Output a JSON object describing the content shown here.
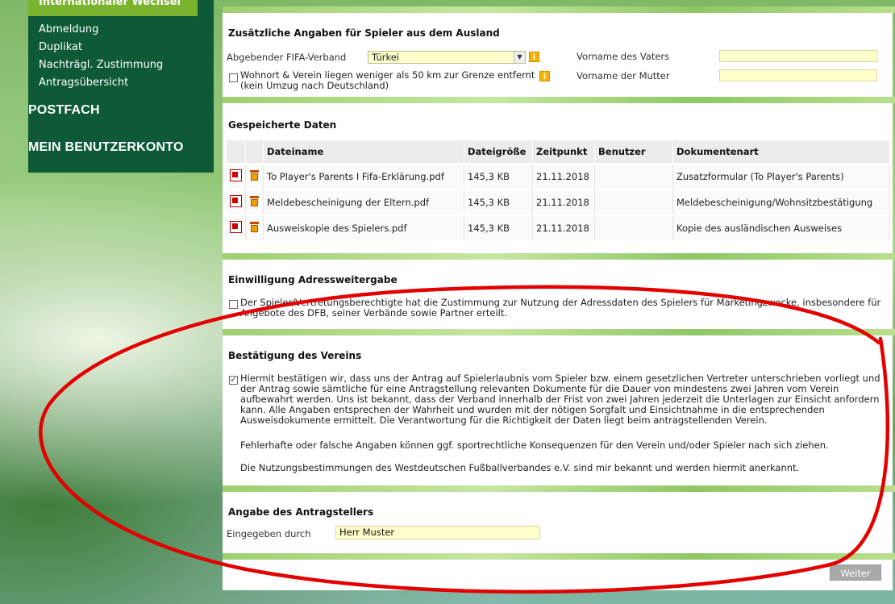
{
  "sidebar": {
    "active_item": "Internationaler Wechsel",
    "items": [
      "Abmeldung",
      "Duplikat",
      "Nachträgl. Zustimmung",
      "Antragsübersicht"
    ],
    "headings": [
      "POSTFACH",
      "MEIN BENUTZERKONTO"
    ]
  },
  "ausland": {
    "title": "Zusätzliche Angaben für Spieler aus dem Ausland",
    "fifa_label": "Abgebender FIFA-Verband",
    "fifa_value": "Türkei",
    "distance_label_1": "Wohnort & Verein liegen weniger als 50 km zur Grenze entfernt",
    "distance_label_2": "(kein Umzug nach Deutschland)",
    "father_label": "Vorname des Vaters",
    "mother_label": "Vorname der Mutter",
    "info_glyph": "i"
  },
  "files": {
    "title": "Gespeicherte Daten",
    "columns": [
      "Dateiname",
      "Dateigröße",
      "Zeitpunkt",
      "Benutzer",
      "Dokumentenart"
    ],
    "rows": [
      {
        "name": "To Player's Parents I Fifa-Erklärung.pdf",
        "size": "145,3 KB",
        "date": "21.11.2018",
        "user": "",
        "type": "Zusatzformular (To Player's Parents)"
      },
      {
        "name": "Meldebescheinigung der Eltern.pdf",
        "size": "145,3 KB",
        "date": "21.11.2018",
        "user": "",
        "type": "Meldebescheinigung/Wohnsitzbestätigung"
      },
      {
        "name": "Ausweiskopie des Spielers.pdf",
        "size": "145,3 KB",
        "date": "21.11.2018",
        "user": "",
        "type": "Kopie des ausländischen Ausweises"
      }
    ]
  },
  "consent": {
    "title": "Einwilligung Adressweitergabe",
    "text_1": "Der Spieler/Vertretungsberechtigte hat die Zustimmung zur Nutzung der Adressdaten des Spielers für Marketingzwecke, insbesondere für",
    "text_2": "Angebote des DFB, seiner Verbände sowie Partner erteilt."
  },
  "verein": {
    "title": "Bestätigung des Vereins",
    "check": "✓",
    "lines": [
      "Hiermit bestätigen wir, dass uns der Antrag auf Spielerlaubnis vom Spieler bzw. einem gesetzlichen Vertreter unterschrieben vorliegt und",
      "der Antrag sowie sämtliche für eine Antragstellung relevanten Dokumente für die Dauer von mindestens zwei Jahren vom Verein",
      "aufbewahrt werden. Uns ist bekannt, dass der Verband innerhalb der Frist von zwei Jahren jederzeit die Unterlagen zur Einsicht anfordern",
      "kann. Alle Angaben entsprechen der Wahrheit und wurden mit der nötigen Sorgfalt und Einsichtnahme in die entsprechenden",
      "Ausweisdokumente ermittelt. Die Verantwortung für die Richtigkeit der Daten liegt beim antragstellenden Verein."
    ],
    "note_1": "Fehlerhafte oder falsche Angaben können ggf. sportrechtliche Konsequenzen für den Verein und/oder Spieler nach sich ziehen.",
    "note_2": "Die Nutzungsbestimmungen des Westdeutschen Fußballverbandes e.V. sind mir bekannt und werden hiermit anerkannt."
  },
  "antragsteller": {
    "title": "Angabe des Antragstellers",
    "label": "Eingegeben durch",
    "value": "Herr Muster"
  },
  "footer": {
    "next_label": "Weiter"
  },
  "colors": {
    "sidebar": "#0e5a36",
    "active": "#7ab42e",
    "field": "#ffffcc",
    "annotation": "#e30000"
  }
}
